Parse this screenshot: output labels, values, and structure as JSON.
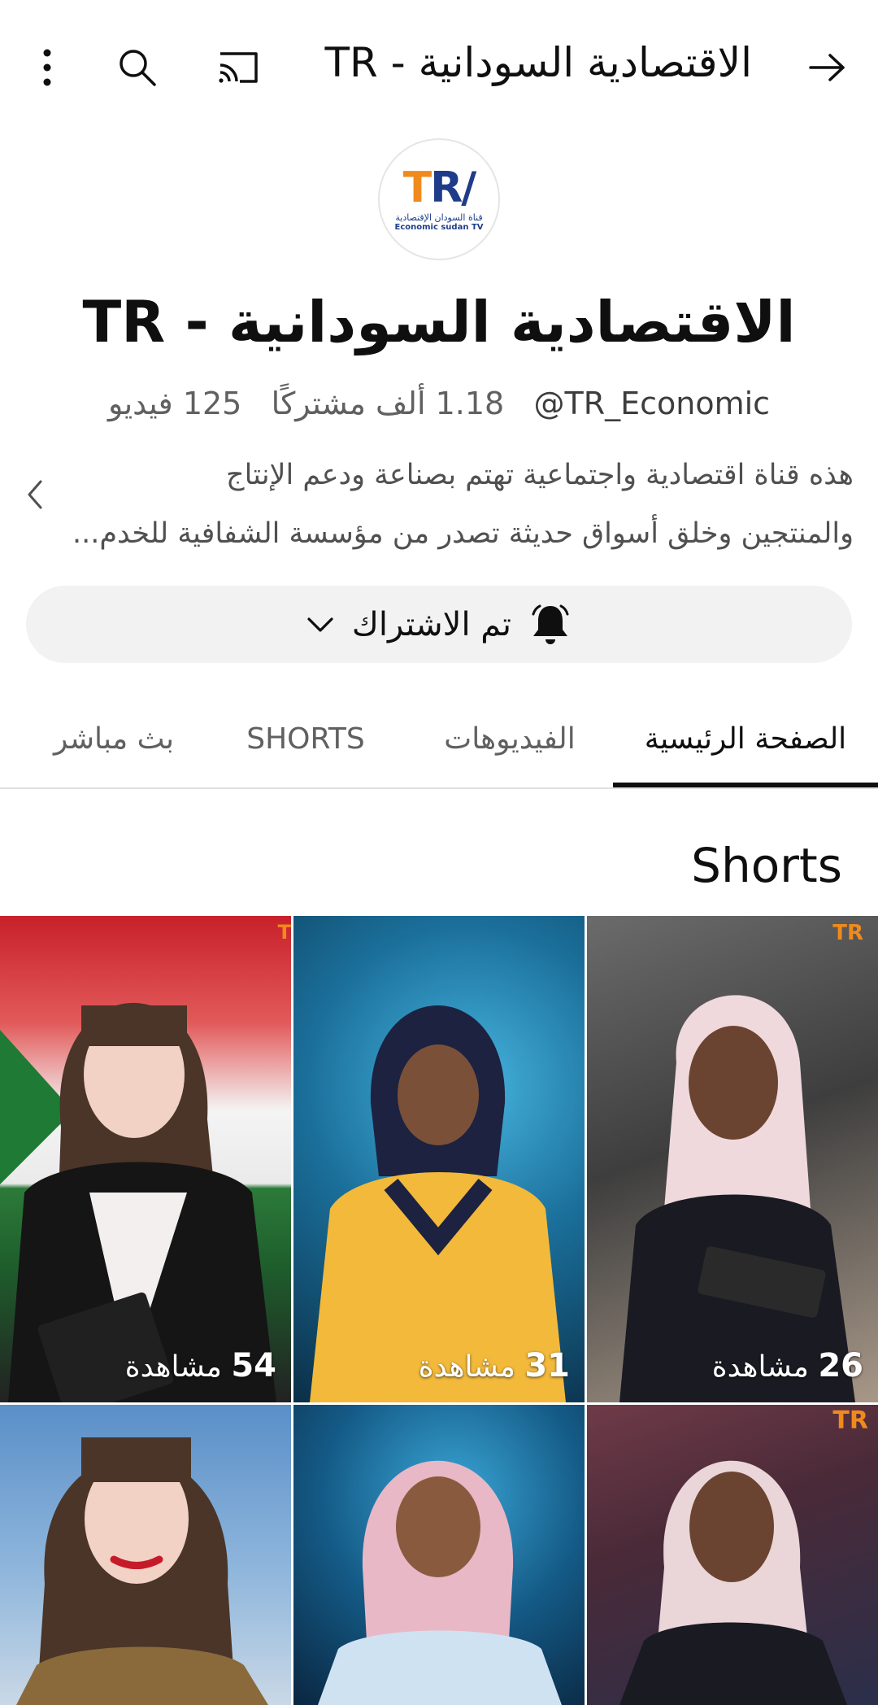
{
  "topbar": {
    "title": "الاقتصادية السودانية - TR",
    "icons": [
      "arrow-right-icon",
      "cast-icon",
      "search-icon",
      "more-vert-icon"
    ]
  },
  "channel": {
    "avatar": {
      "logo_t": "T",
      "logo_rest": "R/",
      "arabic": "قناة السودان الإقتصادية",
      "english": "Economic sudan TV"
    },
    "name": "الاقتصادية السودانية - TR",
    "handle": "@TR_Economic",
    "subs_count": "1.18",
    "subs_label": "ألف مشتركًا",
    "videos_count": "125",
    "videos_label": "فيديو",
    "desc_line1": "هذه قناة اقتصادية واجتماعية تهتم بصناعة ودعم الإنتاج",
    "desc_line2": "والمنتجين وخلق أسواق حديثة تصدر من مؤسسة الشفافية للخدم..."
  },
  "subscribe": {
    "label": "تم الاشتراك"
  },
  "tabs": [
    {
      "label": "الصفحة الرئيسية",
      "active": true
    },
    {
      "label": "الفيديوهات",
      "active": false
    },
    {
      "label": "SHORTS",
      "active": false
    },
    {
      "label": "بث مباشر",
      "active": false
    }
  ],
  "section": {
    "title": "Shorts"
  },
  "shorts": [
    {
      "views_num": "26",
      "views_label": "مشاهدة"
    },
    {
      "views_num": "31",
      "views_label": "مشاهدة"
    },
    {
      "views_num": "54",
      "views_label": "مشاهدة"
    },
    {
      "views_num": "",
      "views_label": ""
    },
    {
      "views_num": "",
      "views_label": ""
    },
    {
      "views_num": "",
      "views_label": ""
    }
  ],
  "colors": {
    "accent": "#0f0f0f",
    "muted": "#606060",
    "chip_bg": "#f2f2f2",
    "logo_orange": "#f08a1c",
    "logo_blue": "#1f3c8a"
  }
}
